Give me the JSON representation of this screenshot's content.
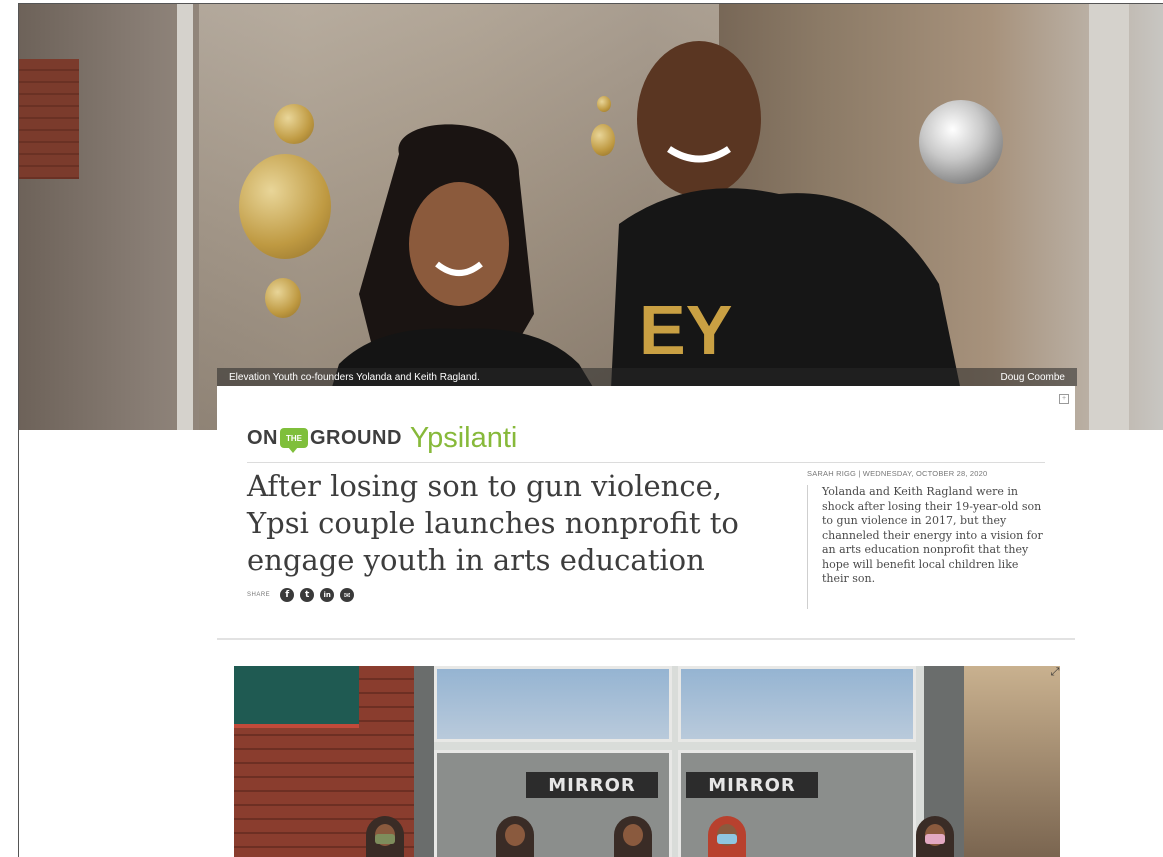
{
  "hero": {
    "caption": "Elevation Youth co-founders Yolanda and Keith Ragland.",
    "credit": "Doug Coombe",
    "shirt_text": "EY"
  },
  "brand": {
    "on": "ON",
    "the": "THE",
    "ground": "GROUND",
    "city": "Ypsilanti",
    "accent_color": "#87b93a"
  },
  "article": {
    "headline": "After losing son to gun violence, Ypsi couple launches nonprofit to engage youth in arts education",
    "byline": "SARAH RIGG | WEDNESDAY, OCTOBER 28, 2020",
    "summary": "Yolanda and Keith Ragland were in shock after losing their 19-year-old son to gun violence in 2017, but they channeled their energy into a vision for an arts education nonprofit that they hope will benefit local children like their son."
  },
  "share": {
    "label": "SHARE",
    "buttons": [
      {
        "icon": "facebook-icon",
        "glyph": "f"
      },
      {
        "icon": "twitter-icon",
        "glyph": "t"
      },
      {
        "icon": "linkedin-icon",
        "glyph": "in"
      },
      {
        "icon": "email-icon",
        "glyph": "✉"
      }
    ]
  },
  "photo2": {
    "sign_left": "MIRROR",
    "sign_right": "MIRROR"
  }
}
